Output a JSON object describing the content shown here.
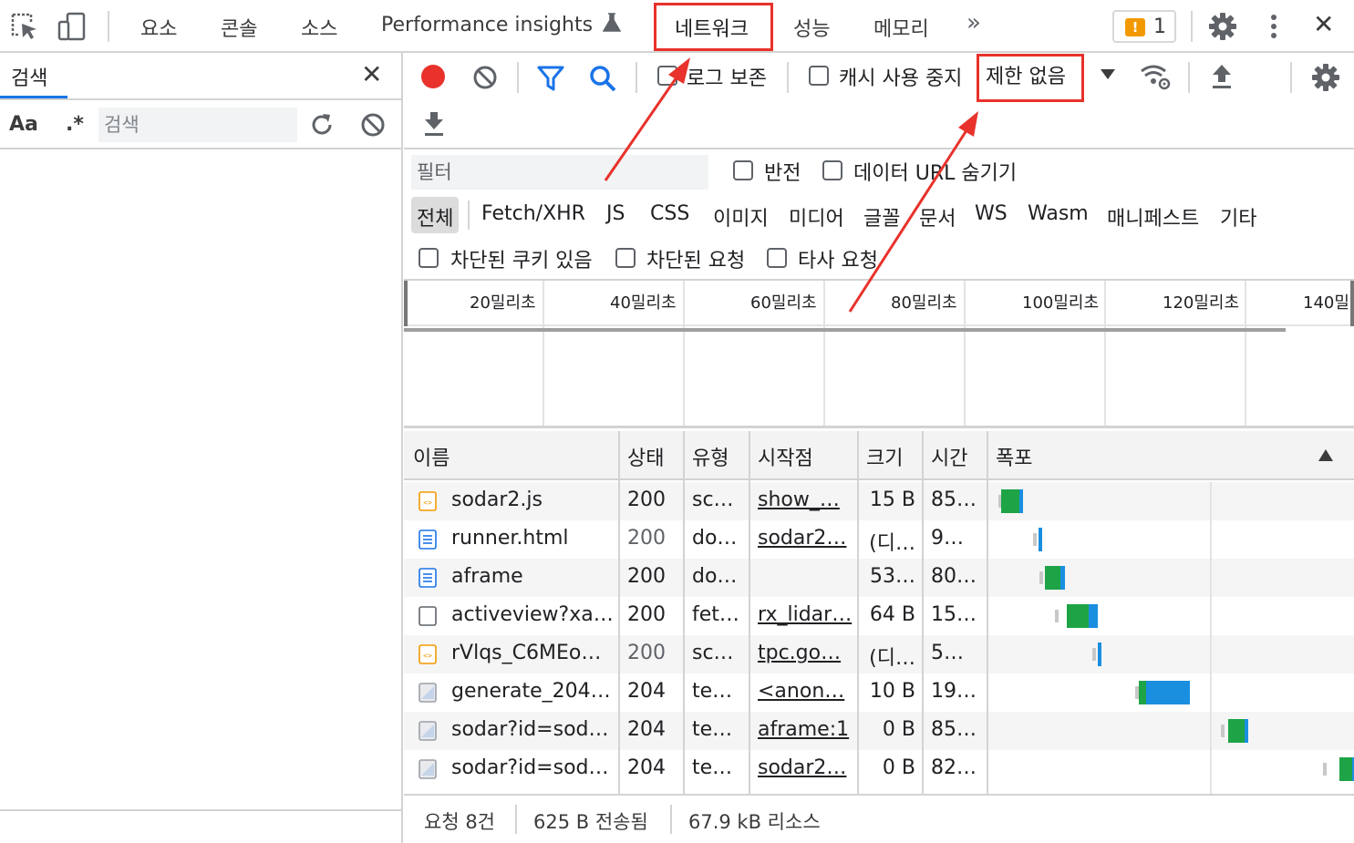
{
  "topbar": {
    "tabs": [
      {
        "label": "요소"
      },
      {
        "label": "콘솔"
      },
      {
        "label": "소스"
      },
      {
        "label": "Performance insights"
      },
      {
        "label": "네트워크"
      },
      {
        "label": "성능"
      },
      {
        "label": "메모리"
      }
    ],
    "more_label": "»",
    "issues_count": "1",
    "close_label": "✕"
  },
  "search_panel": {
    "tab_label": "검색",
    "close_label": "✕",
    "match_case_label": "Aa",
    "regex_label": ".*",
    "input_placeholder": "검색",
    "input_value": ""
  },
  "network_toolbar": {
    "preserve_log_label": "로그 보존",
    "disable_cache_label": "캐시 사용 중지",
    "throttling_value": "제한 없음"
  },
  "filter_bar": {
    "filter_placeholder": "필터",
    "invert_label": "반전",
    "hide_data_urls_label": "데이터 URL 숨기기",
    "types": [
      "전체",
      "Fetch/XHR",
      "JS",
      "CSS",
      "이미지",
      "미디어",
      "글꼴",
      "문서",
      "WS",
      "Wasm",
      "매니페스트",
      "기타"
    ],
    "active_type": "전체",
    "blocked_cookies_label": "차단된 쿠키 있음",
    "blocked_requests_label": "차단된 요청",
    "third_party_label": "타사 요청"
  },
  "overview": {
    "tick_labels": [
      "20밀리초",
      "40밀리초",
      "60밀리초",
      "80밀리초",
      "100밀리초",
      "120밀리초",
      "140밀"
    ]
  },
  "table": {
    "headers": {
      "name": "이름",
      "status": "상태",
      "type": "유형",
      "initiator": "시작점",
      "size": "크기",
      "time": "시간",
      "waterfall": "폭포"
    },
    "rows": [
      {
        "icon": "script-file-icon",
        "name": "sodar2.js",
        "status": "200",
        "type": "sc…",
        "initiator": "show_…",
        "size": "15 B",
        "time": "85…"
      },
      {
        "icon": "document-file-icon",
        "name": "runner.html",
        "status": "200",
        "type": "do…",
        "initiator": "sodar2…",
        "size": "(디…",
        "time": "9…"
      },
      {
        "icon": "document-file-icon",
        "name": "aframe",
        "status": "200",
        "type": "do…",
        "initiator": "",
        "size": "53…",
        "time": "80…"
      },
      {
        "icon": "blank-file-icon",
        "name": "activeview?xa…",
        "status": "200",
        "type": "fet…",
        "initiator": "rx_lidar…",
        "size": "64 B",
        "time": "15…"
      },
      {
        "icon": "script-file-icon",
        "name": "rVlqs_C6MEo…",
        "status": "200",
        "type": "sc…",
        "initiator": "tpc.go…",
        "size": "(디…",
        "time": "5…"
      },
      {
        "icon": "image-file-icon",
        "name": "generate_204…",
        "status": "204",
        "type": "te…",
        "initiator": "<anon…",
        "size": "10 B",
        "time": "19…"
      },
      {
        "icon": "image-file-icon",
        "name": "sodar?id=sod…",
        "status": "204",
        "type": "te…",
        "initiator": "aframe:1",
        "size": "0 B",
        "time": "85…"
      },
      {
        "icon": "image-file-icon",
        "name": "sodar?id=sod…",
        "status": "204",
        "type": "te…",
        "initiator": "sodar2…",
        "size": "0 B",
        "time": "82…"
      }
    ]
  },
  "status_bar": {
    "requests": "요청 8건",
    "transferred": "625 B 전송됨",
    "resources": "67.9 kB 리소스"
  },
  "colors": {
    "annotation": "#e8322b",
    "record": "#e8322b",
    "accent_blue": "#1a73e8",
    "waterfall_green": "#1ea446",
    "waterfall_blue": "#1a8fe0"
  }
}
